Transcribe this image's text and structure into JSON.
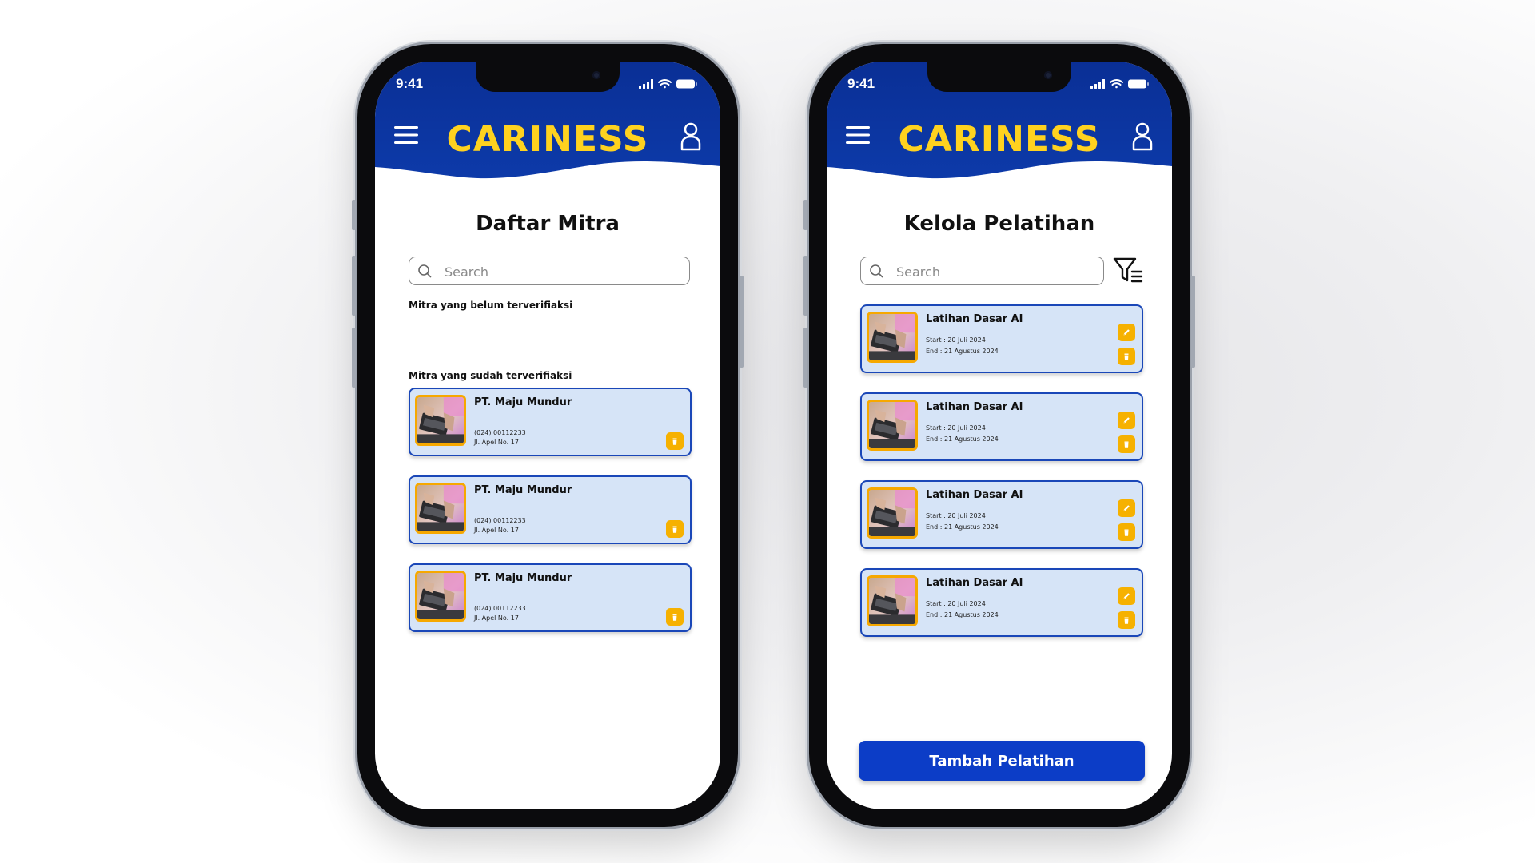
{
  "status_bar": {
    "time": "9:41"
  },
  "app": {
    "title": "CARINESS",
    "colors": {
      "primary": "#0c3dc7",
      "header": "#0d3aa9",
      "accent": "#FFD21F",
      "card": "#d6e4f7",
      "action": "#f6b100"
    }
  },
  "mitra_screen": {
    "page_title": "Daftar Mitra",
    "search_placeholder": "Search",
    "unverified_label": "Mitra yang belum terverifiaksi",
    "verified_label": "Mitra yang sudah terverifiaksi",
    "cards": [
      {
        "name": "PT. Maju Mundur",
        "phone": "(024) 00112233",
        "address": "Jl. Apel No. 17"
      },
      {
        "name": "PT. Maju Mundur",
        "phone": "(024) 00112233",
        "address": "Jl. Apel No. 17"
      },
      {
        "name": "PT. Maju Mundur",
        "phone": "(024) 00112233",
        "address": "Jl. Apel No. 17"
      }
    ]
  },
  "pelatihan_screen": {
    "page_title": "Kelola Pelatihan",
    "search_placeholder": "Search",
    "cards": [
      {
        "name": "Latihan Dasar AI",
        "start": "Start : 20 Juli 2024",
        "end": "End : 21 Agustus 2024"
      },
      {
        "name": "Latihan Dasar AI",
        "start": "Start : 20 Juli 2024",
        "end": "End : 21 Agustus 2024"
      },
      {
        "name": "Latihan Dasar AI",
        "start": "Start : 20 Juli 2024",
        "end": "End : 21 Agustus 2024"
      },
      {
        "name": "Latihan Dasar AI",
        "start": "Start : 20 Juli 2024",
        "end": "End : 21 Agustus 2024"
      }
    ],
    "add_button": "Tambah Pelatihan"
  },
  "icons": [
    "menu-icon",
    "user-icon",
    "search-icon",
    "filter-icon",
    "edit-icon",
    "trash-icon",
    "signal-icon",
    "wifi-icon",
    "battery-icon"
  ]
}
